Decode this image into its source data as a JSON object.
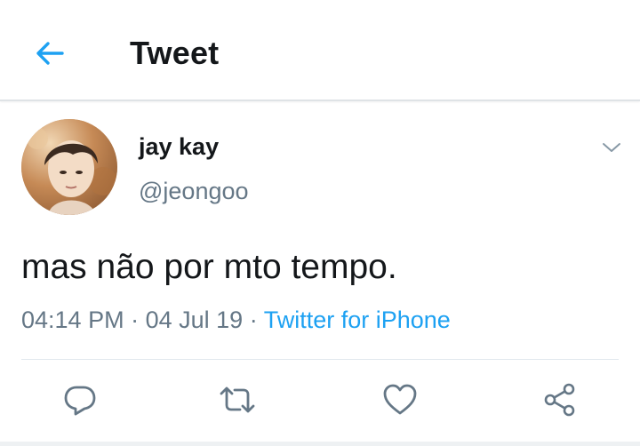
{
  "header": {
    "title": "Tweet",
    "back_icon": "back-arrow-icon"
  },
  "tweet": {
    "author_name": "jay kay",
    "author_handle": "@jeongoo",
    "text": "mas não por mto tempo.",
    "time": "04:14 PM",
    "separator": "·",
    "date": "04 Jul 19",
    "source": "Twitter for iPhone"
  },
  "actions": [
    {
      "name": "reply",
      "icon": "reply-icon"
    },
    {
      "name": "retweet",
      "icon": "retweet-icon"
    },
    {
      "name": "like",
      "icon": "heart-icon"
    },
    {
      "name": "share",
      "icon": "share-icon"
    }
  ],
  "colors": {
    "accent": "#1da1f2",
    "text": "#14171a",
    "secondary": "#657786",
    "icon": "#657786",
    "divider": "#e1e8ed"
  }
}
